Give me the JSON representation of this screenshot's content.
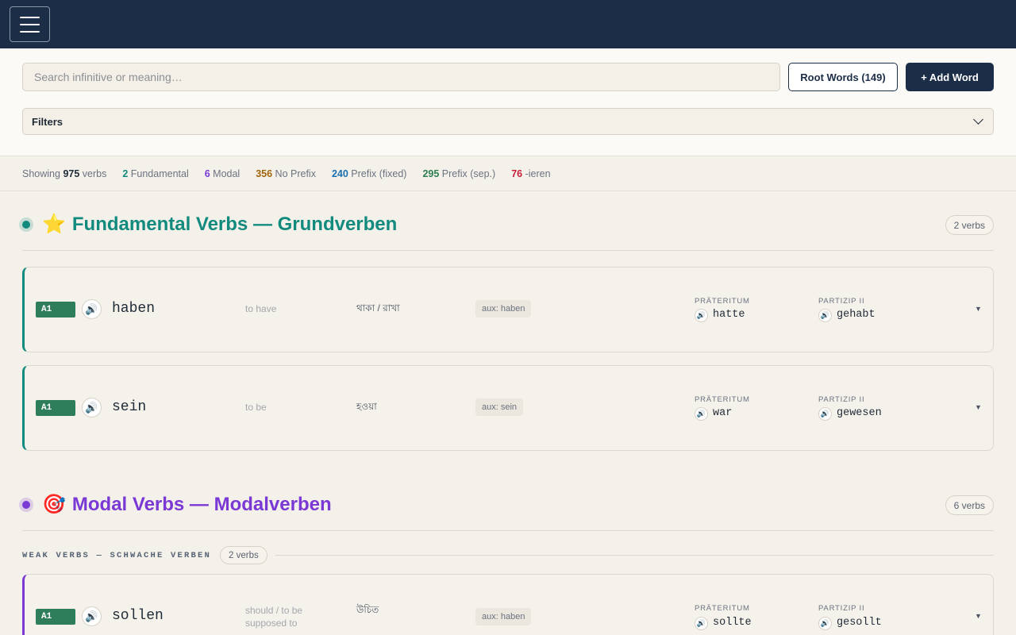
{
  "header": {
    "menu_icon": "hamburger-menu-icon"
  },
  "controls": {
    "search_placeholder": "Search infinitive or meaning…",
    "search_value": "",
    "root_words_label": "Root Words (149)",
    "add_word_label": "+ Add Word",
    "filters_label": "Filters"
  },
  "stats": {
    "showing_prefix": "Showing ",
    "showing_count": "975",
    "showing_suffix": " verbs",
    "categories": [
      {
        "count": "2",
        "label": " Fundamental",
        "color": "#138a7e"
      },
      {
        "count": "6",
        "label": " Modal",
        "color": "#7a38d4"
      },
      {
        "count": "356",
        "label": " No Prefix",
        "color": "#a0650b"
      },
      {
        "count": "240",
        "label": " Prefix (fixed)",
        "color": "#1a6fb0"
      },
      {
        "count": "295",
        "label": " Prefix (sep.)",
        "color": "#2e7d4f"
      },
      {
        "count": "76",
        "label": " -ieren",
        "color": "#c81e3a"
      }
    ]
  },
  "sections": [
    {
      "emoji": "⭐",
      "title": "Fundamental Verbs — Grundverben",
      "count": "2 verbs",
      "color": "#138a7e",
      "verbs": [
        {
          "level": "A1",
          "infinitive": "haben",
          "meaning": "to have",
          "bengali": "থাকা / রাখা",
          "aux": "aux: haben",
          "praeteritum_label": "PRÄTERITUM",
          "praeteritum": "hatte",
          "partizip_label": "PARTIZIP II",
          "partizip": "gehabt"
        },
        {
          "level": "A1",
          "infinitive": "sein",
          "meaning": "to be",
          "bengali": "হওয়া",
          "aux": "aux: sein",
          "praeteritum_label": "PRÄTERITUM",
          "praeteritum": "war",
          "partizip_label": "PARTIZIP II",
          "partizip": "gewesen"
        }
      ]
    },
    {
      "emoji": "🎯",
      "title": "Modal Verbs — Modalverben",
      "count": "6 verbs",
      "color": "#7a38d4",
      "subsection": {
        "label": "WEAK VERBS — SCHWACHE VERBEN",
        "count": "2 verbs"
      },
      "verbs": [
        {
          "level": "A1",
          "infinitive": "sollen",
          "meaning": "should / to be supposed to",
          "bengali": "উচিত",
          "aux": "aux: haben",
          "praeteritum_label": "PRÄTERITUM",
          "praeteritum": "sollte",
          "partizip_label": "PARTIZIP II",
          "partizip": "gesollt"
        }
      ]
    }
  ],
  "icons": {
    "speaker": "speaker-icon",
    "expand": "expand-caret-icon"
  }
}
